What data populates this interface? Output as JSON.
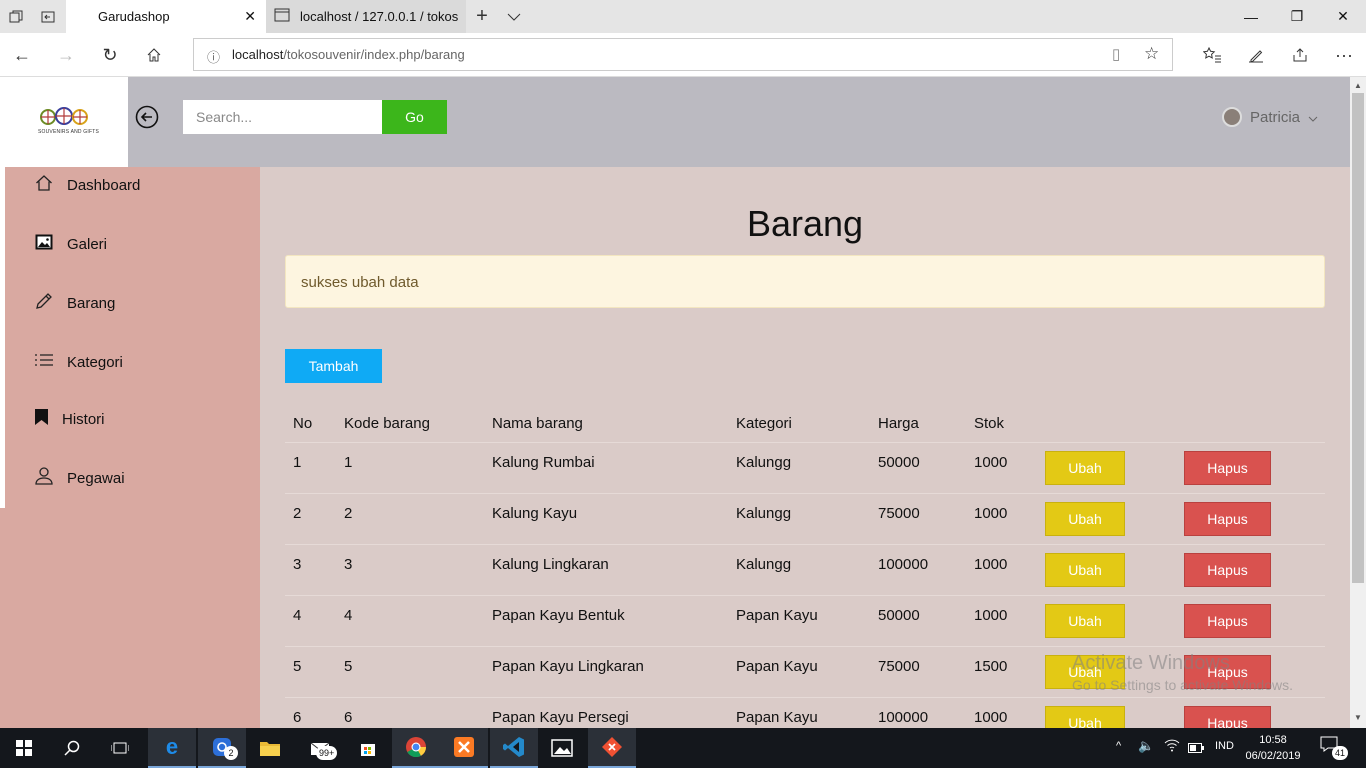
{
  "browser": {
    "tabs": [
      {
        "label": "Garudashop",
        "active": true
      },
      {
        "label": "localhost / 127.0.0.1 / tokos",
        "active": false
      }
    ],
    "url_host": "localhost",
    "url_path": "/tokosouvenir/index.php/barang"
  },
  "header": {
    "logo_text": "SOUVENIRS AND GIFTS",
    "search_placeholder": "Search...",
    "go_label": "Go",
    "user_name": "Patricia"
  },
  "sidebar": {
    "items": [
      {
        "label": "Dashboard",
        "icon": "home-icon"
      },
      {
        "label": "Galeri",
        "icon": "image-icon"
      },
      {
        "label": "Barang",
        "icon": "pencil-icon"
      },
      {
        "label": "Kategori",
        "icon": "list-icon"
      },
      {
        "label": "Histori",
        "icon": "bookmark-icon"
      },
      {
        "label": "Pegawai",
        "icon": "user-icon"
      }
    ]
  },
  "main": {
    "title": "Barang",
    "alert": "sukses ubah data",
    "add_label": "Tambah",
    "table": {
      "headers": [
        "No",
        "Kode barang",
        "Nama barang",
        "Kategori",
        "Harga",
        "Stok"
      ],
      "edit_label": "Ubah",
      "delete_label": "Hapus",
      "rows": [
        [
          "1",
          "1",
          "Kalung Rumbai",
          "Kalungg",
          "50000",
          "1000"
        ],
        [
          "2",
          "2",
          "Kalung Kayu",
          "Kalungg",
          "75000",
          "1000"
        ],
        [
          "3",
          "3",
          "Kalung Lingkaran",
          "Kalungg",
          "100000",
          "1000"
        ],
        [
          "4",
          "4",
          "Papan Kayu Bentuk",
          "Papan Kayu",
          "50000",
          "1000"
        ],
        [
          "5",
          "5",
          "Papan Kayu Lingkaran",
          "Papan Kayu",
          "75000",
          "1500"
        ],
        [
          "6",
          "6",
          "Papan Kayu Persegi",
          "Papan Kayu",
          "100000",
          "1000"
        ]
      ]
    }
  },
  "watermark": {
    "line1": "Activate Windows",
    "line2": "Go to Settings to activate Windows."
  },
  "taskbar": {
    "badge_instagram": "2",
    "badge_mail": "99+",
    "language": "IND",
    "time": "10:58",
    "date": "06/02/2019",
    "notifications": "41"
  },
  "colors": {
    "header_bg": "#bbbac1",
    "sidebar_bg": "#d9a9a1",
    "main_bg": "#dacbc8",
    "go_button": "#3cb61b",
    "add_button": "#0faaf5",
    "edit_button": "#e3c915",
    "delete_button": "#d9524f"
  }
}
